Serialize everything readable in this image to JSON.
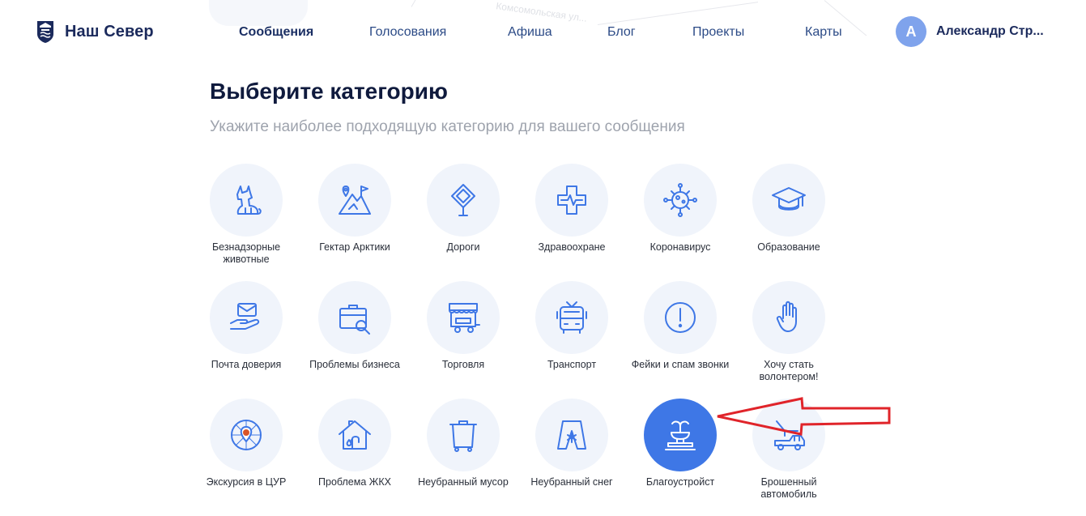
{
  "header": {
    "logo_text": "Наш Север",
    "nav": [
      {
        "label": "Сообщения",
        "active": true
      },
      {
        "label": "Голосования",
        "active": false
      },
      {
        "label": "Афиша",
        "active": false
      },
      {
        "label": "Блог",
        "active": false
      },
      {
        "label": "Проекты",
        "active": false
      },
      {
        "label": "Карты",
        "active": false
      }
    ],
    "user": {
      "initial": "А",
      "name": "Александр Стр..."
    }
  },
  "map_label": "Комсомольская ул...",
  "title": "Выберите категорию",
  "subtitle": "Укажите наиболее подходящую категорию для вашего сообщения",
  "categories": [
    {
      "icon": "dog-icon",
      "label": "Безнадзорные животные",
      "selected": false
    },
    {
      "icon": "mountain-flag-icon",
      "label": "Гектар Арктики",
      "selected": false
    },
    {
      "icon": "road-sign-icon",
      "label": "Дороги",
      "selected": false
    },
    {
      "icon": "medical-cross-icon",
      "label": "Здравоохране",
      "selected": false
    },
    {
      "icon": "virus-icon",
      "label": "Коронавирус",
      "selected": false
    },
    {
      "icon": "graduation-cap-icon",
      "label": "Образование",
      "selected": false
    },
    {
      "icon": "envelope-hand-icon",
      "label": "Почта доверия",
      "selected": false
    },
    {
      "icon": "briefcase-search-icon",
      "label": "Проблемы бизнеса",
      "selected": false
    },
    {
      "icon": "market-stall-icon",
      "label": "Торговля",
      "selected": false
    },
    {
      "icon": "bus-icon",
      "label": "Транспорт",
      "selected": false
    },
    {
      "icon": "exclamation-icon",
      "label": "Фейки и спам звонки",
      "selected": false
    },
    {
      "icon": "raised-hand-icon",
      "label": "Хочу стать волонтером!",
      "selected": false
    },
    {
      "icon": "map-pin-icon",
      "label": "Экскурсия в ЦУР",
      "selected": false
    },
    {
      "icon": "house-faucet-icon",
      "label": "Проблема ЖКХ",
      "selected": false
    },
    {
      "icon": "trash-bin-icon",
      "label": "Неубранный мусор",
      "selected": false
    },
    {
      "icon": "snow-sign-icon",
      "label": "Неубранный снег",
      "selected": false
    },
    {
      "icon": "fountain-icon",
      "label": "Благоустройст",
      "selected": true
    },
    {
      "icon": "tow-truck-icon",
      "label": "Брошенный автомобиль",
      "selected": false
    }
  ],
  "colors": {
    "accent": "#3e77e6",
    "icon_stroke": "#3e77e6",
    "circle_bg": "#f0f4fb",
    "annotation_arrow": "#e0242a"
  }
}
